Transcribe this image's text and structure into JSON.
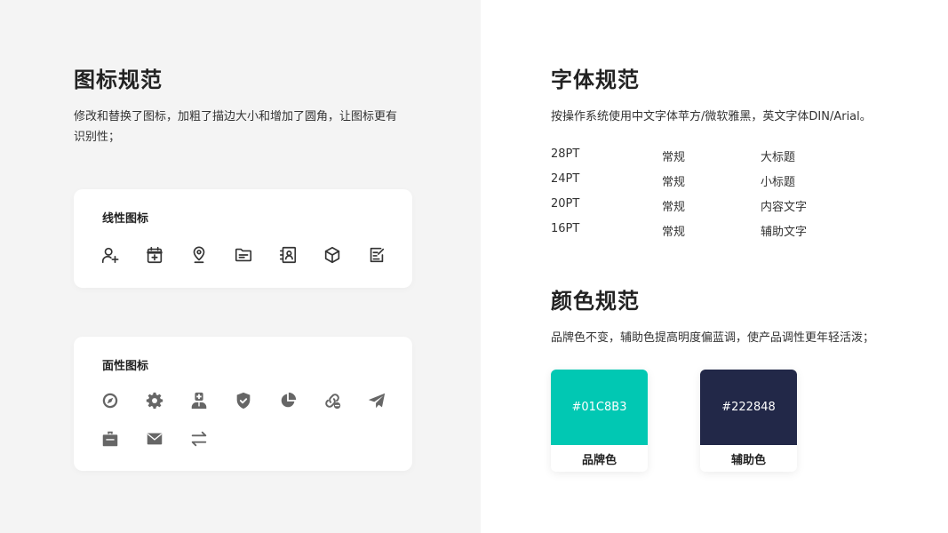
{
  "icons_section": {
    "title_hl": "图标",
    "title_rest": "规范",
    "desc_line1": "修改和替换了图标，加粗了描边大小和增加了圆角，让图标更有",
    "desc_line2": "识别性；",
    "line_card": {
      "title": "线性图标",
      "icons": [
        "add-user-icon",
        "calendar-add-icon",
        "location-pin-icon",
        "folder-icon",
        "contacts-icon",
        "cube-icon",
        "edit-note-icon"
      ]
    },
    "solid_card": {
      "title": "面性图标",
      "icons": [
        "compass-icon",
        "gear-icon",
        "doctor-icon",
        "shield-check-icon",
        "pie-chart-icon",
        "link-remove-icon",
        "paper-plane-icon",
        "briefcase-icon",
        "mail-icon",
        "swap-icon"
      ]
    }
  },
  "font_section": {
    "title_hl": "字体",
    "title_rest": "规范",
    "desc": "按操作系统使用中文字体苹方/微软雅黑，英文字体DIN/Arial。",
    "rows": [
      {
        "size": "28PT",
        "weight": "常规",
        "usage": "大标题"
      },
      {
        "size": "24PT",
        "weight": "常规",
        "usage": "小标题"
      },
      {
        "size": "20PT",
        "weight": "常规",
        "usage": "内容文字"
      },
      {
        "size": "16PT",
        "weight": "常规",
        "usage": "辅助文字"
      }
    ]
  },
  "color_section": {
    "title_hl": "颜色",
    "title_rest": "规范",
    "desc": "品牌色不变，辅助色提高明度偏蓝调，使产品调性更年轻活泼；",
    "swatches": [
      {
        "hex": "#01C8B3",
        "label": "品牌色",
        "color": "#01C8B3"
      },
      {
        "hex": "#222848",
        "label": "辅助色",
        "color": "#222848"
      }
    ]
  },
  "accent_color": "#e8651a"
}
